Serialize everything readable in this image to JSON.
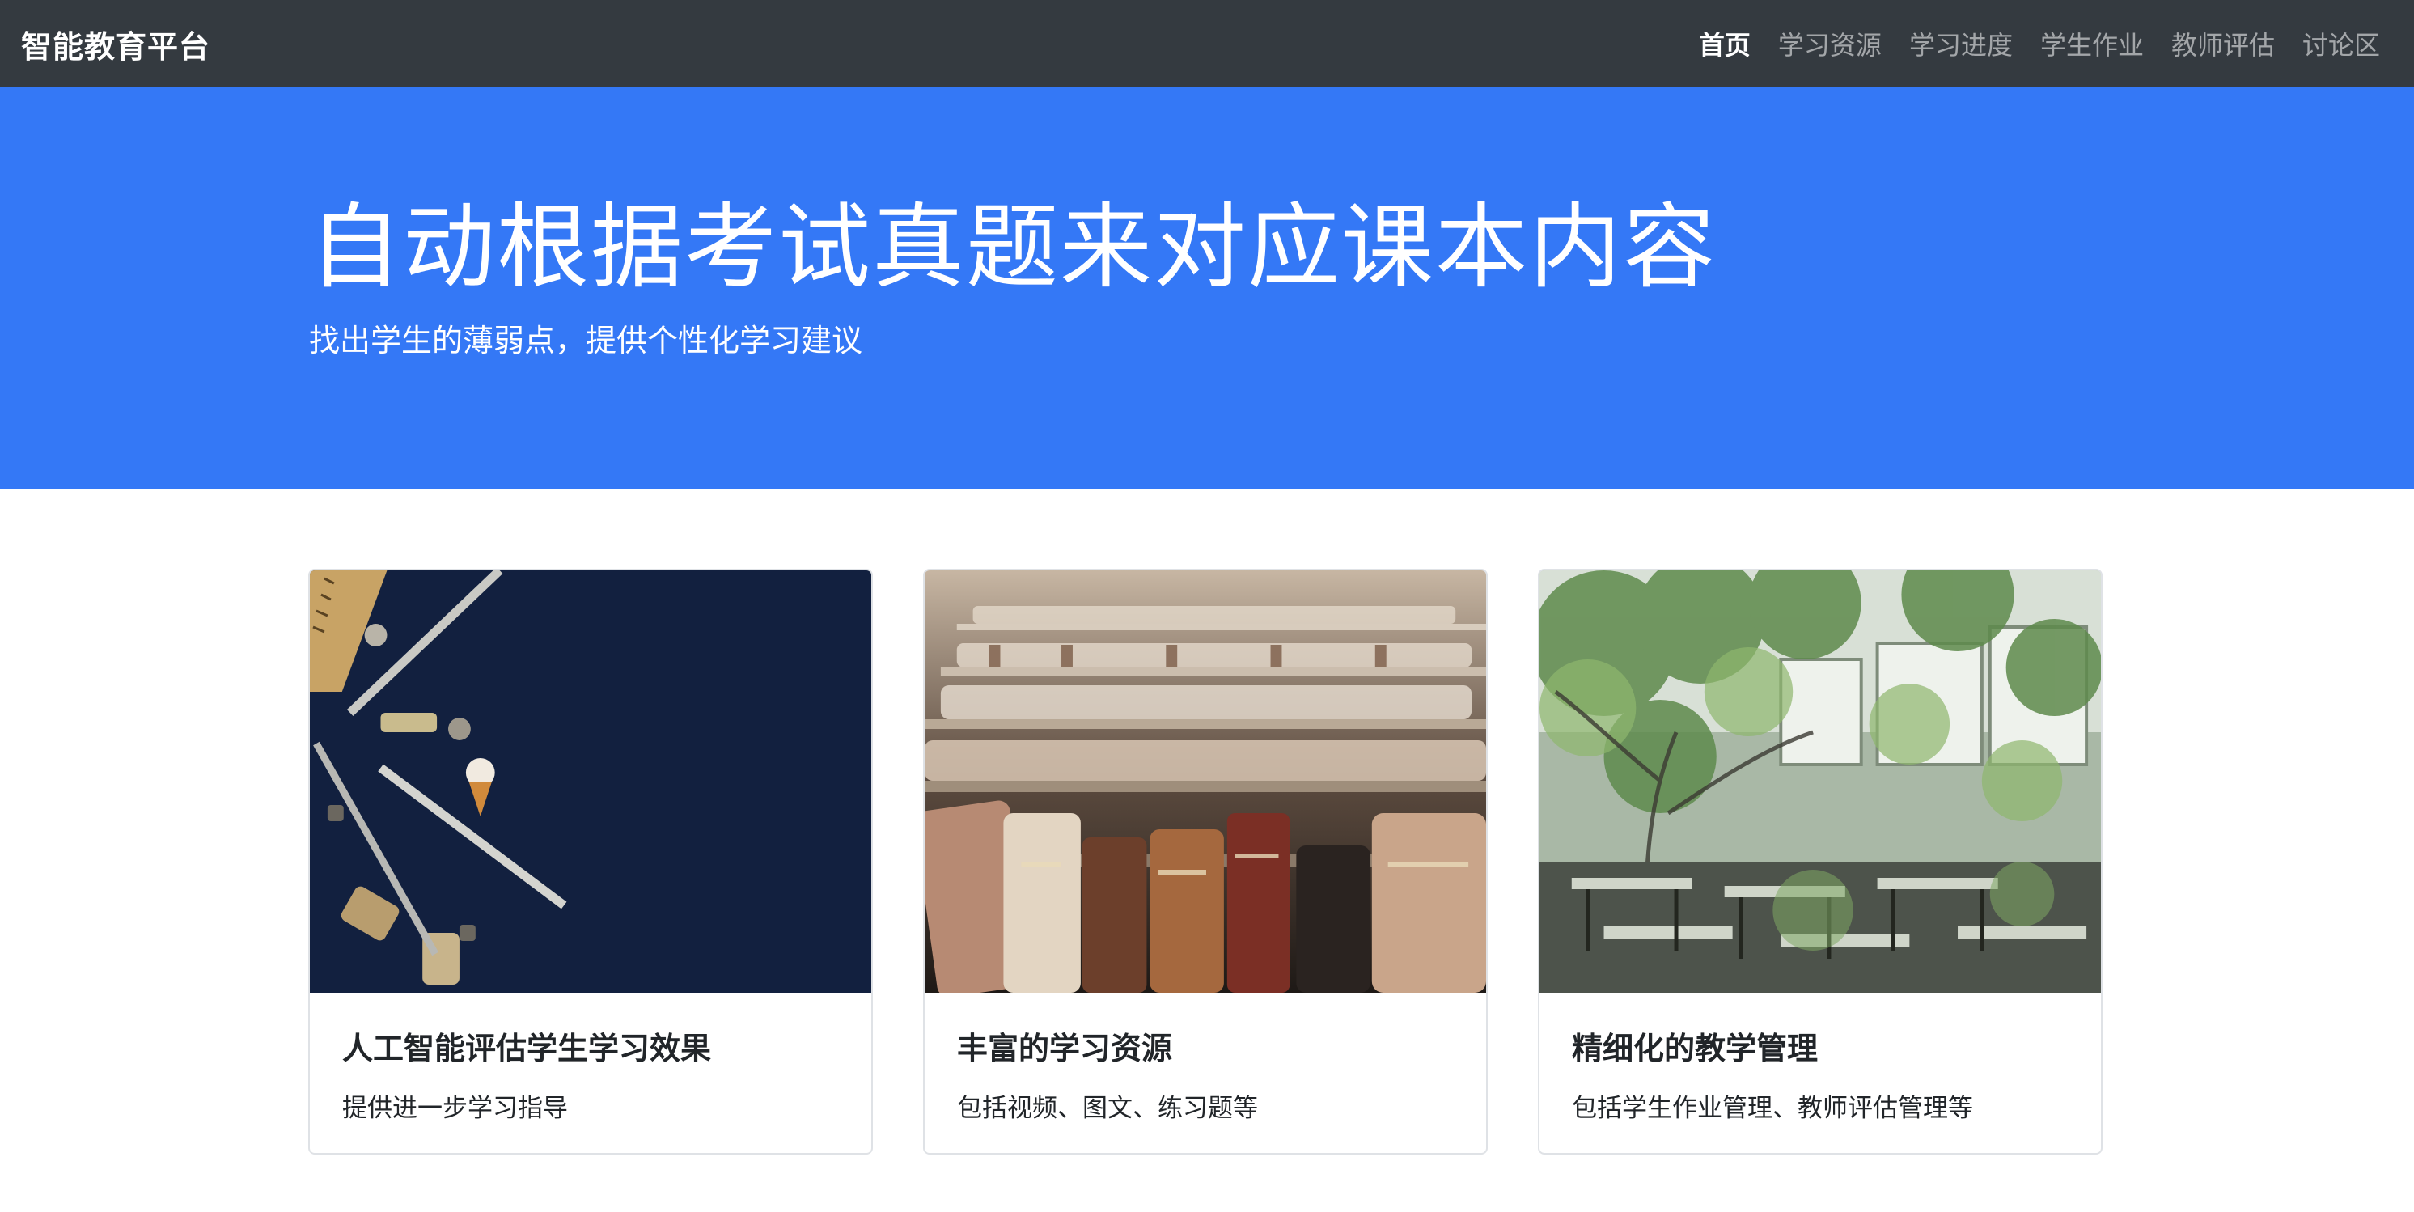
{
  "navbar": {
    "brand": "智能教育平台",
    "links": [
      {
        "label": "首页",
        "active": true
      },
      {
        "label": "学习资源",
        "active": false
      },
      {
        "label": "学习进度",
        "active": false
      },
      {
        "label": "学生作业",
        "active": false
      },
      {
        "label": "教师评估",
        "active": false
      },
      {
        "label": "讨论区",
        "active": false
      }
    ]
  },
  "hero": {
    "title": "自动根据考试真题来对应课本内容",
    "subtitle": "找出学生的薄弱点，提供个性化学习建议"
  },
  "cards": [
    {
      "title": "人工智能评估学生学习效果",
      "text": "提供进一步学习指导",
      "image": "stationery-on-navy-photo"
    },
    {
      "title": "丰富的学习资源",
      "text": "包括视频、图文、练习题等",
      "image": "old-books-on-shelves-photo"
    },
    {
      "title": "精细化的教学管理",
      "text": "包括学生作业管理、教师评估管理等",
      "image": "classroom-with-trees-photo"
    }
  ],
  "colors": {
    "navbar_bg": "#343a40",
    "hero_bg": "#3478f6",
    "card_border": "#dfe2e6",
    "text_dark": "#212529"
  }
}
